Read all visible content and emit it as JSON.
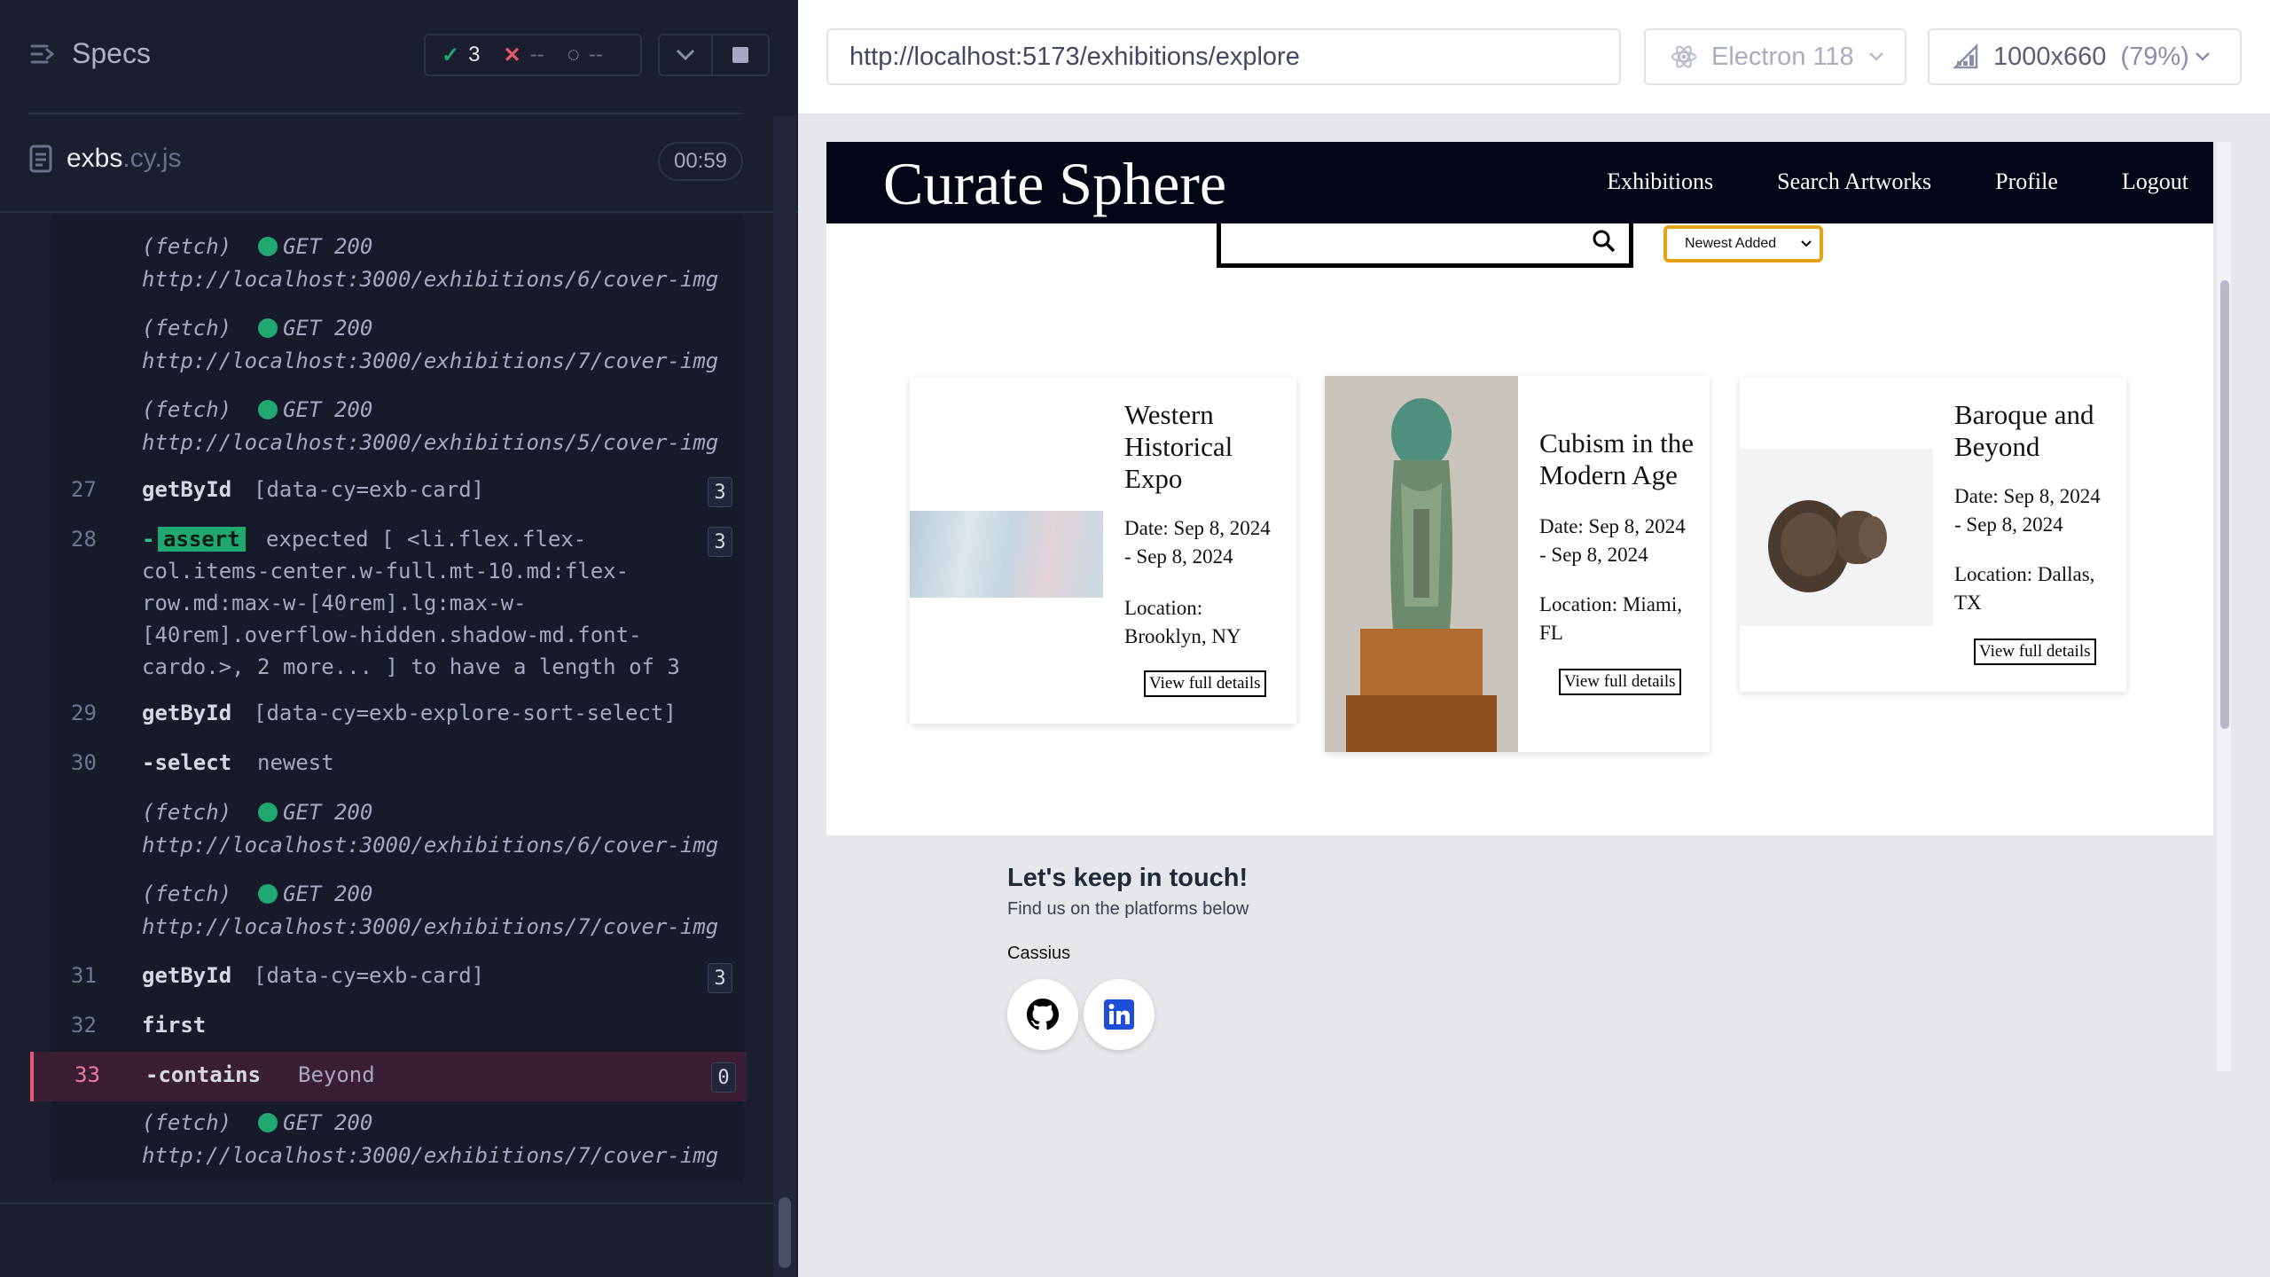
{
  "runner": {
    "specs_label": "Specs",
    "passed": "3",
    "failed": "--",
    "pending": "--",
    "file_name": "exbs",
    "file_ext": ".cy.js",
    "timer": "00:59"
  },
  "log": {
    "fetch_label": "(fetch)",
    "get_label": "GET 200",
    "url6": "http://localhost:3000/exhibitions/6/cover-img",
    "url7": "http://localhost:3000/exhibitions/7/cover-img",
    "url5": "http://localhost:3000/exhibitions/5/cover-img",
    "cmd27": {
      "num": "27",
      "name": "getById",
      "msg": "[data-cy=exb-card]",
      "count": "3"
    },
    "cmd28": {
      "num": "28",
      "dash": "-",
      "tag": "assert",
      "count": "3",
      "line1": "expected [ <li.flex.flex-",
      "line2": "col.items-center.w-full.mt-10.md:flex-",
      "line3": "row.md:max-w-[40rem].lg:max-w-",
      "line4": "[40rem].overflow-hidden.shadow-md.font-",
      "line5": "cardo.>, 2 more... ] to have a length of 3"
    },
    "cmd29": {
      "num": "29",
      "name": "getById",
      "msg": "[data-cy=exb-explore-sort-select]"
    },
    "cmd30": {
      "num": "30",
      "name": "-select",
      "msg": "newest"
    },
    "cmd31": {
      "num": "31",
      "name": "getById",
      "msg": "[data-cy=exb-card]",
      "count": "3"
    },
    "cmd32": {
      "num": "32",
      "name": "first"
    },
    "cmd33": {
      "num": "33",
      "name": "-contains",
      "msg": "Beyond",
      "count": "0"
    }
  },
  "browser": {
    "url": "http://localhost:5173/exhibitions/explore",
    "engine": "Electron 118",
    "viewport": "1000x660",
    "scale": "(79%)"
  },
  "app": {
    "brand": "Curate Sphere",
    "nav": [
      "Exhibitions",
      "Search Artworks",
      "Profile",
      "Logout"
    ],
    "sort_selected": "Newest Added",
    "cards": [
      {
        "title_lines": [
          "Western",
          "Historical",
          "Expo"
        ],
        "date_lines": [
          "Date: Sep 8, 2024",
          "- Sep 8, 2024"
        ],
        "loc_lines": [
          "Location:",
          "Brooklyn, NY"
        ],
        "button": "View full details"
      },
      {
        "title_lines": [
          "Cubism in the",
          "Modern Age"
        ],
        "date_lines": [
          "Date: Sep 8, 2024",
          "- Sep 8, 2024"
        ],
        "loc_lines": [
          "Location: Miami,",
          "FL"
        ],
        "button": "View full details"
      },
      {
        "title_lines": [
          "Baroque and",
          "Beyond"
        ],
        "date_lines": [
          "Date: Sep 8, 2024",
          "- Sep 8, 2024"
        ],
        "loc_lines": [
          "Location: Dallas,",
          "TX"
        ],
        "button": "View full details"
      }
    ],
    "footer": {
      "title": "Let's keep in touch!",
      "subtitle": "Find us on the platforms below",
      "name": "Cassius"
    }
  },
  "icons": {
    "specs": "specs-list-icon",
    "file": "document-icon",
    "search": "search-icon",
    "github": "github-icon",
    "linkedin": "linkedin-icon"
  },
  "colors": {
    "pass": "#1fa971",
    "fail": "#e45770",
    "nav_bg": "#020617",
    "select_border": "#e5a31a",
    "linkedin": "#1d4ed8"
  }
}
